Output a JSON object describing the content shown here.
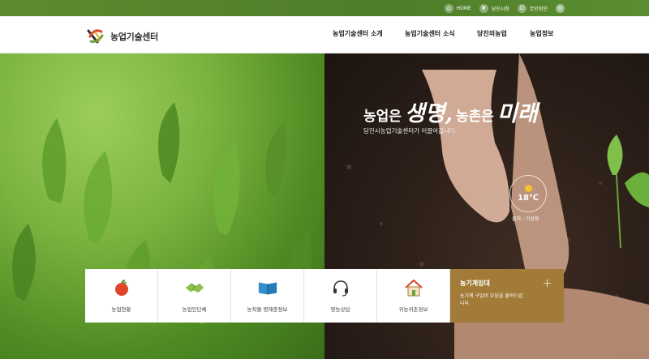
{
  "topbar": {
    "links": [
      {
        "label": "HOME",
        "icon": "home-icon"
      },
      {
        "label": "당진시청",
        "icon": "leaf-icon"
      },
      {
        "label": "본인확인",
        "icon": "lock-icon"
      }
    ],
    "menu_icon": "menu-icon"
  },
  "header": {
    "logo_text": "농업기술센터",
    "nav": [
      "농업기술센터 소개",
      "농업기술센터 소식",
      "당진의농업",
      "농업정보"
    ]
  },
  "hero": {
    "slogan_part1": "농업은",
    "slogan_part2": "생명,",
    "slogan_part3": "농촌은",
    "slogan_part4": "미래",
    "subtitle": "당진시농업기술센터가 이끌어갑니다.",
    "weather": {
      "temperature": "18℃",
      "source": "출처 : 기상청",
      "icon": "sun-icon"
    }
  },
  "quick_menu": {
    "items": [
      {
        "label": "농업현황",
        "icon": "apple-icon"
      },
      {
        "label": "농업인단체",
        "icon": "handshake-icon"
      },
      {
        "label": "농작물 병해충정보",
        "icon": "book-icon"
      },
      {
        "label": "영농상담",
        "icon": "headset-icon"
      },
      {
        "label": "귀농귀촌정보",
        "icon": "house-icon"
      }
    ],
    "feature": {
      "title": "농기계임대",
      "description": "농기계 구입비 부담을 줄여드립니다.",
      "plus": "+"
    }
  },
  "colors": {
    "topbar": "#5a8a2e",
    "feature_bg": "#a17b37",
    "sun": "#f4c22b"
  }
}
